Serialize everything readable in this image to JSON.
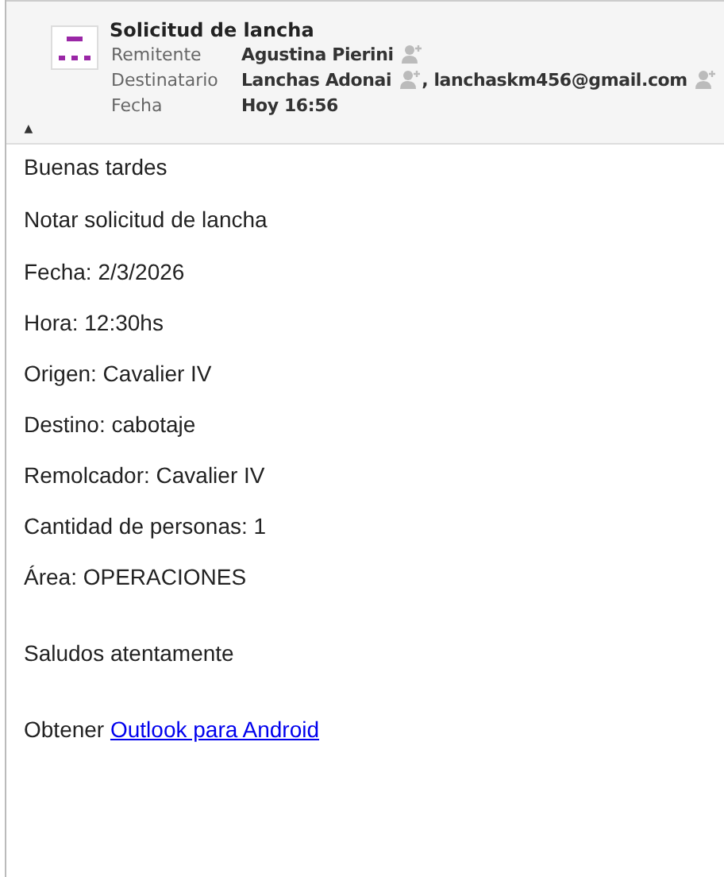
{
  "header": {
    "subject": "Solicitud de lancha",
    "collapse_toggle": "▲",
    "fields": [
      {
        "label": "Remitente",
        "values": [
          {
            "text": "Agustina Pierini",
            "add_contact": true
          }
        ]
      },
      {
        "label": "Destinatario",
        "values": [
          {
            "text": "Lanchas Adonai",
            "add_contact": true
          },
          {
            "text": ", lanchaskm456@gmail.com",
            "add_contact": true
          }
        ]
      },
      {
        "label": "Fecha",
        "values": [
          {
            "text": "Hoy 16:56",
            "add_contact": false
          }
        ]
      }
    ]
  },
  "body": {
    "groups": [
      [
        "Buenas tardes"
      ],
      [
        "Notar solicitud de lancha"
      ],
      [
        "Fecha: 2/3/2026",
        "Hora: 12:30hs",
        "Origen: Cavalier IV",
        "Destino: cabotaje",
        "Remolcador: Cavalier IV",
        "Cantidad de personas: 1",
        "Área: OPERACIONES"
      ],
      [
        "Saludos atentamente"
      ]
    ],
    "signature": {
      "text": "Obtener",
      "link": "Outlook para Android"
    }
  }
}
